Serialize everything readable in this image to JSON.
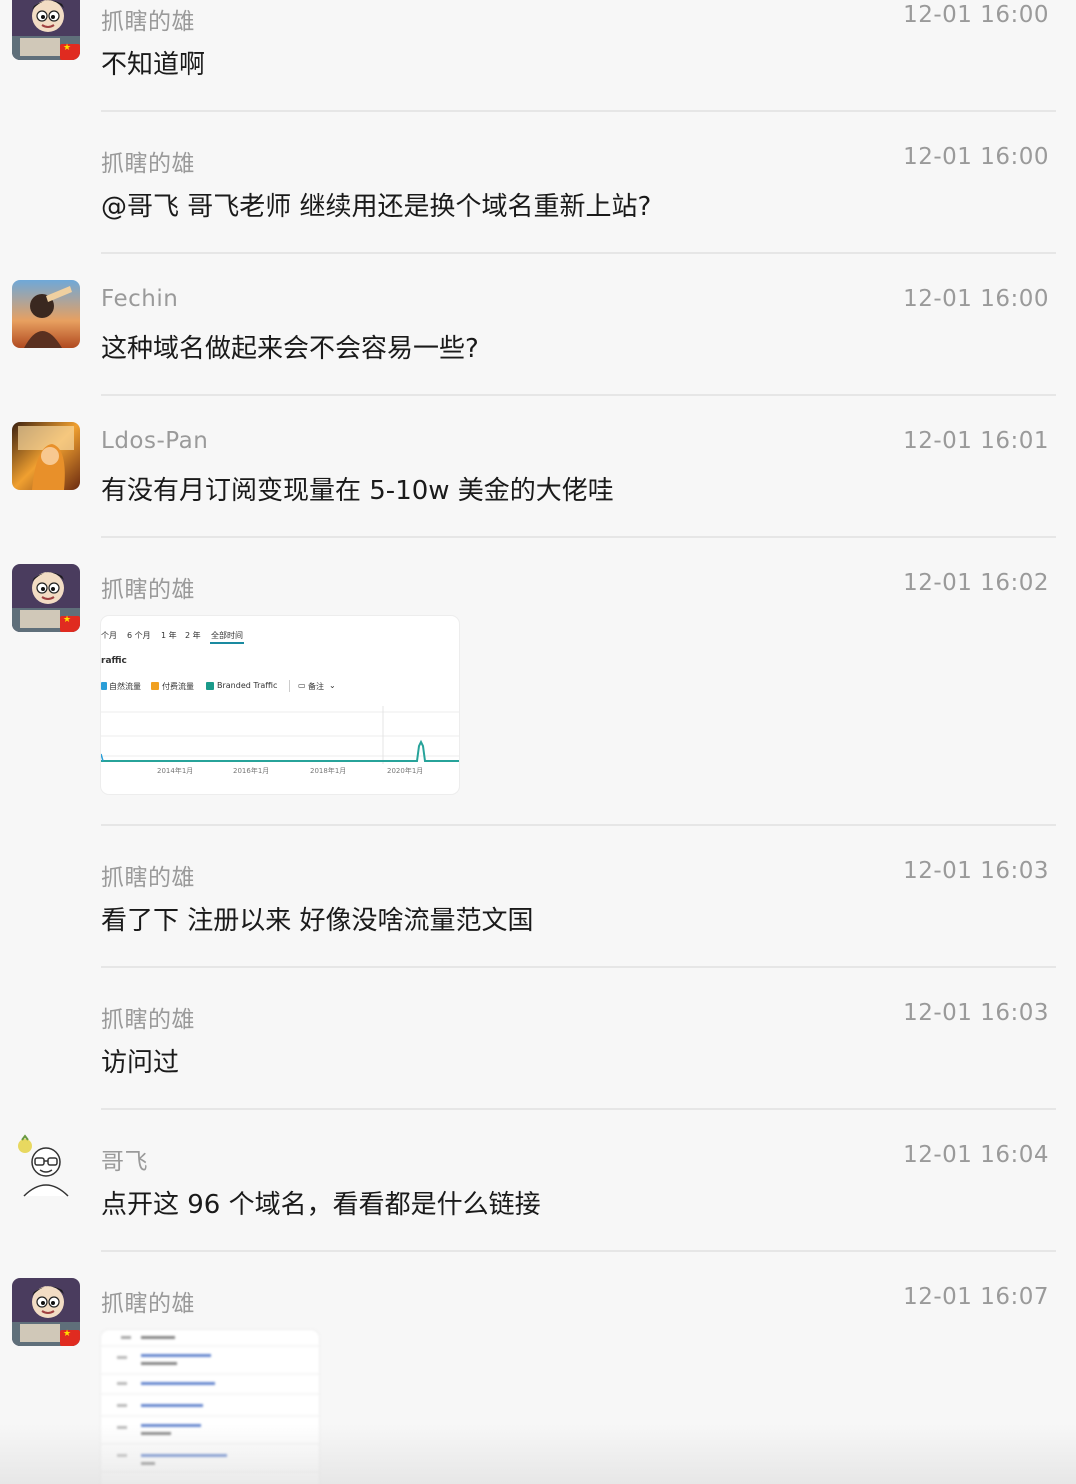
{
  "messages": [
    {
      "name": "抓瞎的雄",
      "time": "12-01 16:00",
      "text": "不知道啊",
      "avatar": "cartoon-boy-avatar",
      "flag": true
    },
    {
      "name": "抓瞎的雄",
      "time": "12-01 16:00",
      "text": "@哥飞 哥飞老师  继续用还是换个域名重新上站?"
    },
    {
      "name": "Fechin",
      "time": "12-01 16:00",
      "text": "这种域名做起来会不会容易一些?",
      "avatar": "sunset-portrait-avatar"
    },
    {
      "name": "Ldos-Pan",
      "time": "12-01 16:01",
      "text": "有没有月订阅变现量在 5-10w 美金的大佬哇",
      "avatar": "golden-hair-avatar"
    },
    {
      "name": "抓瞎的雄",
      "time": "12-01 16:02",
      "avatar": "cartoon-boy-avatar",
      "flag": true,
      "image": {
        "tabs": [
          "个月",
          "6 个月",
          "1 年",
          "2 年",
          "全部时间"
        ],
        "title": "raffic",
        "legend": [
          "自然流量",
          "付费流量",
          "Branded Traffic",
          "备注"
        ],
        "xlabels": [
          "2014年1月",
          "2016年1月",
          "2018年1月",
          "2020年1月"
        ],
        "colors": {
          "organic": "#2a9ed8",
          "paid": "#f0a020",
          "branded": "#1a9a8a",
          "line": "#27a39a"
        }
      }
    },
    {
      "name": "抓瞎的雄",
      "time": "12-01 16:03",
      "text": "看了下 注册以来 好像没啥流量范文国"
    },
    {
      "name": "抓瞎的雄",
      "time": "12-01 16:03",
      "text": "访问过"
    },
    {
      "name": "哥飞",
      "time": "12-01 16:04",
      "text": "点开这 96 个域名，看看都是什么链接",
      "avatar": "glasses-man-avatar"
    },
    {
      "name": "抓瞎的雄",
      "time": "12-01 16:07",
      "avatar": "cartoon-boy-avatar",
      "flag": true,
      "image2": "domain-list-screenshot"
    }
  ]
}
